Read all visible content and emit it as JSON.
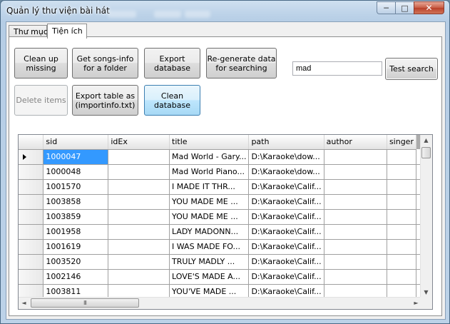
{
  "window": {
    "title": "Quản lý thư viện bài hát",
    "controls": {
      "minimize": "─",
      "maximize": "□",
      "close": "✕"
    }
  },
  "tabs": [
    {
      "label": "Thư mục",
      "active": false
    },
    {
      "label": "Tiện ích",
      "active": true
    }
  ],
  "toolbar": {
    "clean_up_missing": "Clean up missing",
    "get_songs_info": "Get songs-info for a folder",
    "export_database": "Export database",
    "regenerate_data": "Re-generate data for searching",
    "delete_items": "Delete items",
    "export_table": "Export table as (importinfo.txt)",
    "clean_database": "Clean database",
    "test_search": "Test search"
  },
  "search": {
    "value": "mad"
  },
  "grid": {
    "columns": [
      "sid",
      "idEx",
      "title",
      "path",
      "author",
      "singer"
    ],
    "rows": [
      [
        "1000047",
        "",
        "Mad World - Gary...",
        "D:\\Karaoke\\dow...",
        "",
        ""
      ],
      [
        "1000048",
        "",
        "Mad World Piano...",
        "D:\\Karaoke\\dow...",
        "",
        ""
      ],
      [
        "1001570",
        "",
        "I MADE IT THR...",
        "D:\\Karaoke\\Calif...",
        "",
        ""
      ],
      [
        "1003858",
        "",
        "YOU MADE ME ...",
        "D:\\Karaoke\\Calif...",
        "",
        ""
      ],
      [
        "1003859",
        "",
        "YOU MADE ME ...",
        "D:\\Karaoke\\Calif...",
        "",
        ""
      ],
      [
        "1001958",
        "",
        "LADY MADONN...",
        "D:\\Karaoke\\Calif...",
        "",
        ""
      ],
      [
        "1001619",
        "",
        "I WAS MADE FO...",
        "D:\\Karaoke\\Calif...",
        "",
        ""
      ],
      [
        "1003520",
        "",
        "TRULY MADLY ...",
        "D:\\Karaoke\\Calif...",
        "",
        ""
      ],
      [
        "1002146",
        "",
        "LOVE'S MADE A...",
        "D:\\Karaoke\\Calif...",
        "",
        ""
      ],
      [
        "1003811",
        "",
        "YOU'VE MADE ...",
        "D:\\Karaoke\\Calif...",
        "",
        ""
      ]
    ],
    "selected_row": 0,
    "scroll": {
      "up": "▲",
      "down": "▼",
      "left": "◄",
      "right": "►",
      "grip": "III"
    }
  },
  "colors": {
    "selection": "#3399ff",
    "accent_button": "#bee6fd"
  }
}
